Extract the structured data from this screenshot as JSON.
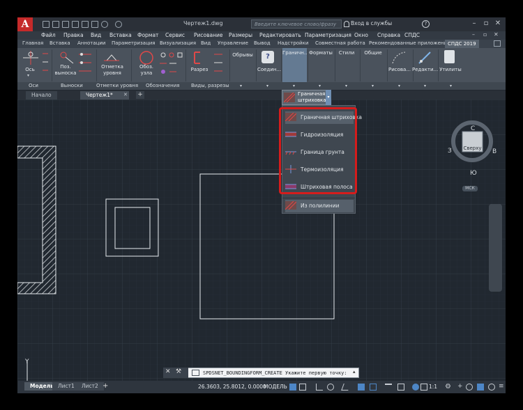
{
  "app": {
    "logo_letter": "A",
    "doc_title": "Чертеж1.dwg",
    "search_placeholder": "Введите ключевое слово/фразу",
    "login": "Вход в службы",
    "colors": {
      "accent": "#c52a2a",
      "highlight": "#d51c1c",
      "canvas": "#212830"
    }
  },
  "menu": [
    "Файл",
    "Правка",
    "Вид",
    "Вставка",
    "Формат",
    "Сервис",
    "Рисование",
    "Размеры",
    "Редактировать",
    "Параметризация",
    "Окно",
    "Справка",
    "СПДС"
  ],
  "ribbon_tabs": [
    "Главная",
    "Вставка",
    "Аннотации",
    "Параметризация",
    "Визуализация",
    "Вид",
    "Управление",
    "Вывод",
    "Надстройки",
    "Совместная работа",
    "Рекомендованные приложения",
    "СПДС 2019"
  ],
  "ribbon": {
    "buttons": {
      "os": "Ось",
      "poz_1": "Поз.",
      "poz_2": "выноска",
      "otm_1": "Отметка",
      "otm_2": "уровня",
      "oboz_1": "Обоз.",
      "oboz_2": "узла",
      "razrez": "Разрез",
      "obryvy": "Обрывы",
      "soedin": "Соедин...",
      "granich": "Граничн...",
      "formaty": "Форматы",
      "stili": "Стили",
      "obschie": "Общие",
      "risova": "Рисова...",
      "redakti": "Редакти...",
      "utility": "Утилиты"
    },
    "groups": [
      "Оси",
      "Выноски",
      "Отметки уровня",
      "Обозначения",
      "Виды, разрезы"
    ]
  },
  "file_tabs": [
    "Начало",
    "Чертеж1*"
  ],
  "dropdown": {
    "header_1": "Граничная",
    "header_2": "штриховка",
    "items": [
      "Граничная штриховка",
      "Гидроизоляция",
      "Граница грунта",
      "Термоизоляция",
      "Штриховая полоса"
    ],
    "footer": "Из полилинии"
  },
  "viewcube": {
    "north": "С",
    "south": "Ю",
    "west": "З",
    "east": "В",
    "face": "Сверху",
    "ucs": "МСК"
  },
  "ucs_axes": {
    "y": "Y",
    "x": "X"
  },
  "command": {
    "text": "SPDSNET_BOUNDINGFORM_CREATE Укажите первую точку:"
  },
  "status": {
    "tabs": [
      "Модель",
      "Лист1",
      "Лист2"
    ],
    "coords": "26.3603, 25.8012, 0.0000",
    "model": "МОДЕЛЬ",
    "scale": "1:1"
  }
}
